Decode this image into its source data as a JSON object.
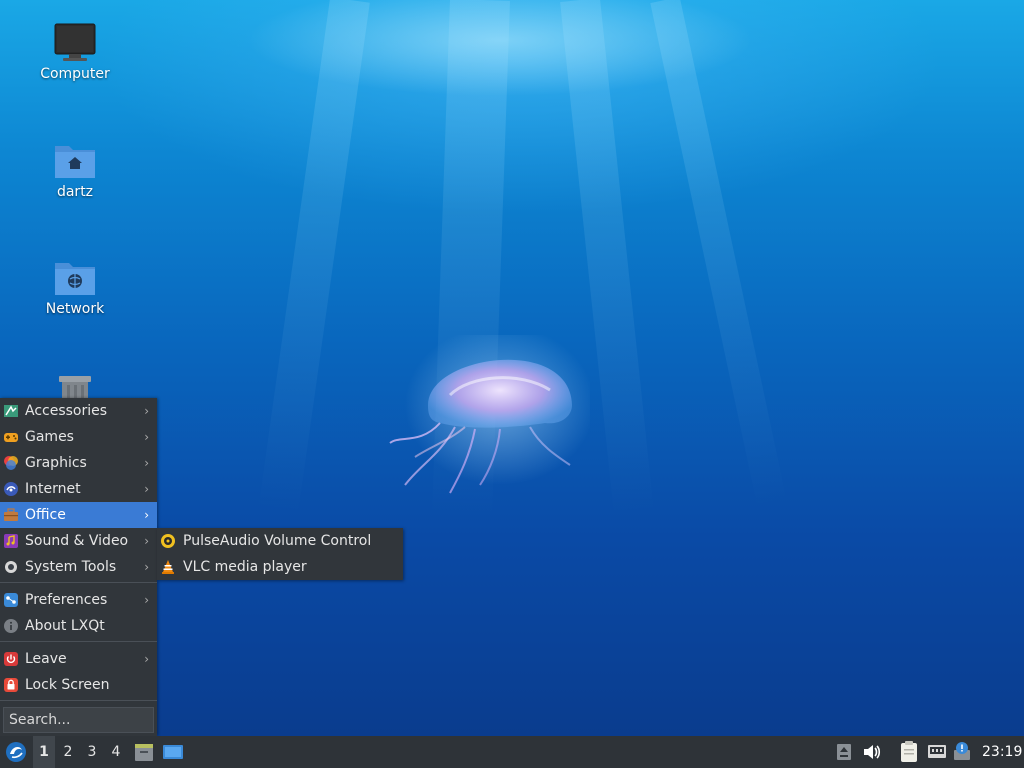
{
  "desktop": {
    "icons": [
      {
        "label": "Computer",
        "icon": "monitor-icon"
      },
      {
        "label": "dartz",
        "icon": "home-folder-icon"
      },
      {
        "label": "Network",
        "icon": "network-folder-icon"
      },
      {
        "label": "",
        "icon": "trash-icon"
      }
    ]
  },
  "menu": {
    "items": [
      {
        "label": "Accessories",
        "icon": "accessories-icon",
        "arrow": "›"
      },
      {
        "label": "Games",
        "icon": "games-icon",
        "arrow": "›"
      },
      {
        "label": "Graphics",
        "icon": "graphics-icon",
        "arrow": "›"
      },
      {
        "label": "Internet",
        "icon": "internet-icon",
        "arrow": "›"
      },
      {
        "label": "Office",
        "icon": "office-icon",
        "arrow": "›"
      },
      {
        "label": "Sound & Video",
        "icon": "sound-video-icon",
        "arrow": "›"
      },
      {
        "label": "System Tools",
        "icon": "system-tools-icon",
        "arrow": "›"
      },
      {
        "label": "Preferences",
        "icon": "preferences-icon",
        "arrow": "›"
      },
      {
        "label": "About LXQt",
        "icon": "info-icon"
      },
      {
        "label": "Leave",
        "icon": "power-icon",
        "arrow": "›"
      },
      {
        "label": "Lock Screen",
        "icon": "lock-icon"
      }
    ],
    "active_item": "Office",
    "search_placeholder": "Search..."
  },
  "submenu": {
    "items": [
      {
        "label": "PulseAudio Volume Control",
        "icon": "pulseaudio-icon"
      },
      {
        "label": "VLC media player",
        "icon": "vlc-icon"
      }
    ]
  },
  "taskbar": {
    "start_icon": "lxqt-logo-icon",
    "workspaces": [
      "1",
      "2",
      "3",
      "4"
    ],
    "current_workspace": "1",
    "quicklaunch": [
      "file-manager-icon",
      "show-desktop-icon"
    ],
    "tray": [
      "tray-expand-icon",
      "volume-icon",
      "clipboard-icon",
      "network-wired-icon",
      "update-notifier-icon"
    ],
    "clock": "23:19"
  },
  "colors": {
    "menu_bg": "#31363b",
    "highlight": "#3a7bd5",
    "taskbar_bg": "#2e3338"
  }
}
